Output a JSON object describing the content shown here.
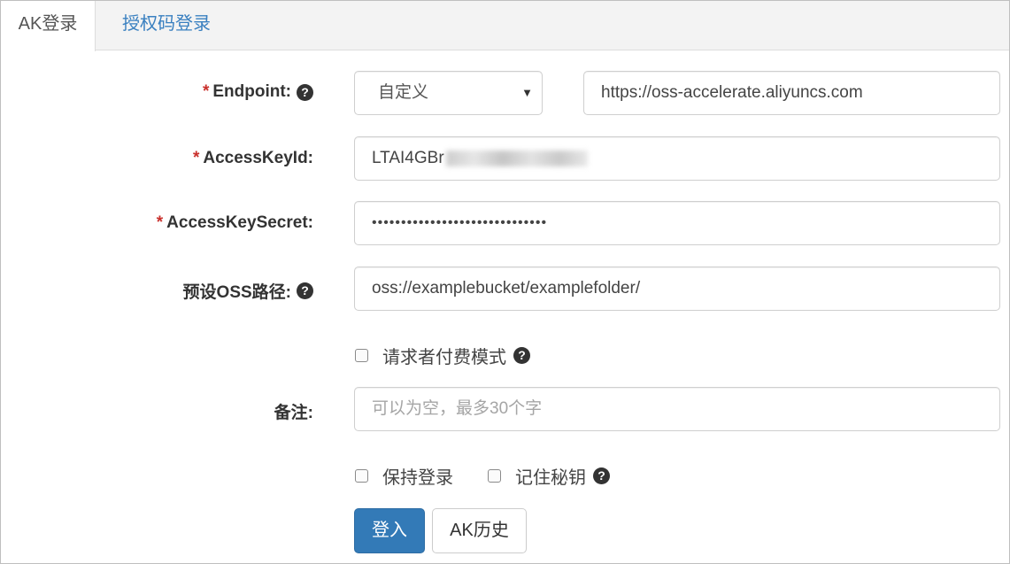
{
  "tabs": [
    {
      "label": "AK登录",
      "active": true
    },
    {
      "label": "授权码登录",
      "active": false
    }
  ],
  "form": {
    "required_mark": "*",
    "endpoint": {
      "label": "Endpoint:",
      "select_value": "自定义",
      "url_value": "https://oss-accelerate.aliyuncs.com"
    },
    "access_key_id": {
      "label": "AccessKeyId:",
      "value_visible": "LTAI4GBr"
    },
    "access_key_secret": {
      "label": "AccessKeySecret:",
      "value": "••••••••••••••••••••••••••••••"
    },
    "oss_path": {
      "label": "预设OSS路径:",
      "value": "oss://examplebucket/examplefolder/"
    },
    "requester_pays": {
      "label": "请求者付费模式",
      "checked": false
    },
    "note": {
      "label": "备注:",
      "placeholder": "可以为空，最多30个字"
    },
    "keep_login": {
      "label": "保持登录",
      "checked": false
    },
    "remember_key": {
      "label": "记住秘钥",
      "checked": false
    },
    "help_glyph": "?",
    "caret_glyph": "▼"
  },
  "buttons": {
    "login": "登入",
    "ak_history": "AK历史"
  },
  "colors": {
    "primary": "#337ab7",
    "required": "#c9302c",
    "tab_link": "#3a80c0"
  }
}
